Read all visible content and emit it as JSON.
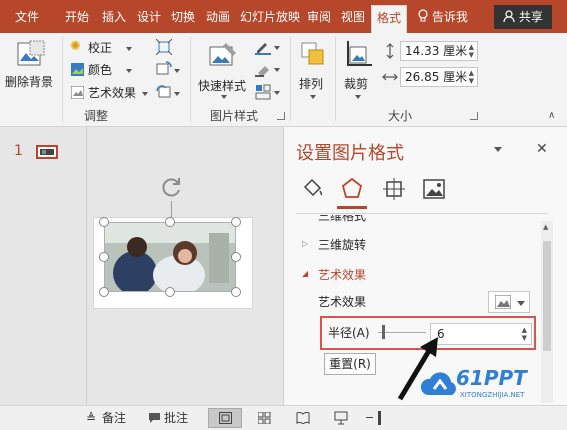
{
  "tabs": [
    "文件",
    "开始",
    "插入",
    "设计",
    "切换",
    "动画",
    "幻灯片放映",
    "审阅",
    "视图",
    "格式"
  ],
  "tell_me": "告诉我",
  "share_label": "共享",
  "ribbon": {
    "remove_bg": "删除背景",
    "corrections": "校正",
    "color": "颜色",
    "artistic": "艺术效果",
    "adjust_group": "调整",
    "quick_styles": "快速样式",
    "picture_styles_group": "图片样式",
    "arrange": "排列",
    "crop": "裁剪",
    "height_value": "14.33 厘米",
    "width_value": "26.85 厘米",
    "size_group": "大小"
  },
  "thumb_number": "1",
  "format_pane": {
    "title": "设置图片格式",
    "sections": [
      "三维格式",
      "三维旋转",
      "艺术效果"
    ],
    "artistic_label": "艺术效果",
    "radius_label": "半径(A)",
    "radius_value": "6",
    "reset_label": "重置(R)"
  },
  "status": {
    "notes": "备注",
    "comments": "批注"
  },
  "watermark": {
    "brand": "61PPT",
    "url": "XITONGZHIJIA.NET"
  },
  "colors": {
    "accent": "#b7472a",
    "highlight": "#d9534f"
  }
}
